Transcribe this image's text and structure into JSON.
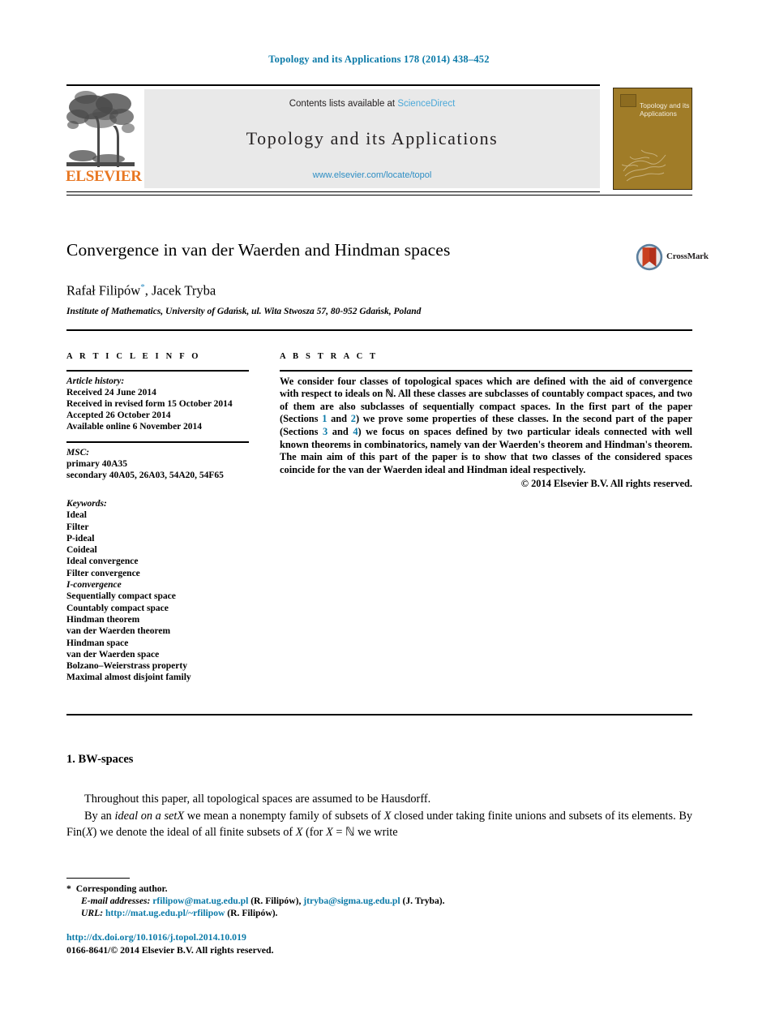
{
  "running_head": "Topology and its Applications 178 (2014) 438–452",
  "masthead": {
    "publisher_name": "ELSEVIER",
    "contents_prefix": "Contents lists available at ",
    "contents_link": "ScienceDirect",
    "journal_title": "Topology and its Applications",
    "journal_url": "www.elsevier.com/locate/topol",
    "cover_title": "Topology and its Applications"
  },
  "article": {
    "title": "Convergence in van der Waerden and Hindman spaces",
    "crossmark_label": "CrossMark",
    "authors": "Rafał Filipów",
    "author_marker": "*",
    "authors_rest": ", Jacek Tryba",
    "affiliation": "Institute of Mathematics, University of Gdańsk, ul. Wita Stwosza 57, 80-952 Gdańsk, Poland"
  },
  "info": {
    "heading": "A R T I C L E   I N F O",
    "history_label": "Article history:",
    "history": [
      "Received 24 June 2014",
      "Received in revised form 15 October 2014",
      "Accepted 26 October 2014",
      "Available online 6 November 2014"
    ],
    "msc_label": "MSC:",
    "msc": [
      "primary 40A35",
      "secondary 40A05, 26A03, 54A20, 54F65"
    ],
    "keywords_label": "Keywords:",
    "keywords": [
      "Ideal",
      "Filter",
      "P-ideal",
      "Coideal",
      "Ideal convergence",
      "Filter convergence",
      "I-convergence",
      "Sequentially compact space",
      "Countably compact space",
      "Hindman theorem",
      "van der Waerden theorem",
      "Hindman space",
      "van der Waerden space",
      "Bolzano–Weierstrass property",
      "Maximal almost disjoint family"
    ]
  },
  "abstract": {
    "heading": "A B S T R A C T",
    "part1": "We consider four classes of topological spaces which are defined with the aid of convergence with respect to ideals on ℕ. All these classes are subclasses of countably compact spaces, and two of them are also subclasses of sequentially compact spaces. In the first part of the paper (Sections ",
    "xref1": "1",
    "between1": " and ",
    "xref2": "2",
    "part2": ") we prove some properties of these classes. In the second part of the paper (Sections ",
    "xref3": "3",
    "between2": " and ",
    "xref4": "4",
    "part3": ") we focus on spaces defined by two particular ideals connected with well known theorems in combinatorics, namely van der Waerden's theorem and Hindman's theorem. The main aim of this part of the paper is to show that two classes of the considered spaces coincide for the van der Waerden ideal and Hindman ideal respectively.",
    "copyright": "© 2014 Elsevier B.V. All rights reserved."
  },
  "body": {
    "section_heading": "1. BW-spaces",
    "para1": "Throughout this paper, all topological spaces are assumed to be Hausdorff.",
    "para2_a": "By an ",
    "para2_ital": "ideal on a set",
    "para2_var1": "X",
    "para2_b": " we mean a nonempty family of subsets of ",
    "para2_var2": "X",
    "para2_c": " closed under taking finite unions and subsets of its elements. By Fin(",
    "para2_var3": "X",
    "para2_d": ") we denote the ideal of all finite subsets of ",
    "para2_var4": "X",
    "para2_e": " (for ",
    "para2_var5": "X",
    "para2_f": " = ℕ we write"
  },
  "footnote": {
    "star": "*",
    "corresponding": "Corresponding author.",
    "email_label": "E-mail addresses:",
    "email1": "rfilipow@mat.ug.edu.pl",
    "email1_who": " (R. Filipów), ",
    "email2": "jtryba@sigma.ug.edu.pl",
    "email2_who": " (J. Tryba).",
    "url_label": "URL:",
    "url": "http://mat.ug.edu.pl/~rfilipow",
    "url_who": " (R. Filipów)."
  },
  "footer": {
    "doi": "http://dx.doi.org/10.1016/j.topol.2014.10.019",
    "issn_line": "0166-8641/© 2014 Elsevier B.V. All rights reserved."
  },
  "colors": {
    "link_blue": "#0b7aa8",
    "sciencedirect_blue": "#4ba8d8",
    "elsevier_orange": "#e87722",
    "cover_gold": "#a07c28"
  }
}
